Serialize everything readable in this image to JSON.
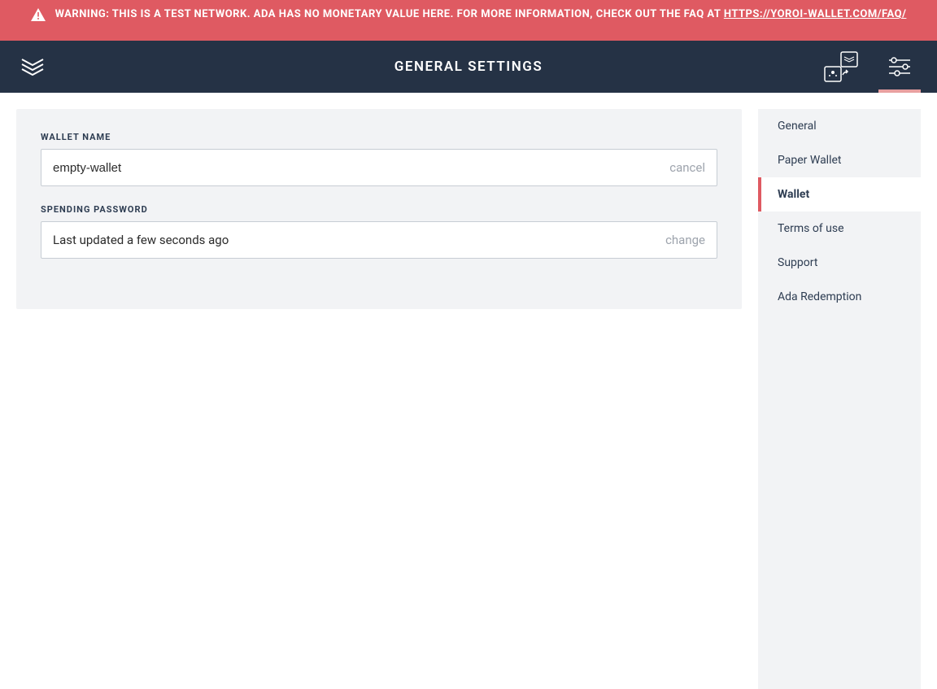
{
  "warning": {
    "text_before_link": "WARNING: THIS IS A TEST NETWORK. ADA HAS NO MONETARY VALUE HERE. FOR MORE INFORMATION, CHECK OUT THE FAQ AT ",
    "link_text": "HTTPS://YOROI-WALLET.COM/FAQ/"
  },
  "header": {
    "title": "GENERAL SETTINGS"
  },
  "form": {
    "wallet_name": {
      "label": "WALLET NAME",
      "value": "empty-wallet",
      "action": "cancel"
    },
    "spending_password": {
      "label": "SPENDING PASSWORD",
      "status": "Last updated a few seconds ago",
      "action": "change"
    }
  },
  "sidebar": {
    "items": [
      {
        "label": "General",
        "active": false
      },
      {
        "label": "Paper Wallet",
        "active": false
      },
      {
        "label": "Wallet",
        "active": true
      },
      {
        "label": "Terms of use",
        "active": false
      },
      {
        "label": "Support",
        "active": false
      },
      {
        "label": "Ada Redemption",
        "active": false
      }
    ]
  }
}
